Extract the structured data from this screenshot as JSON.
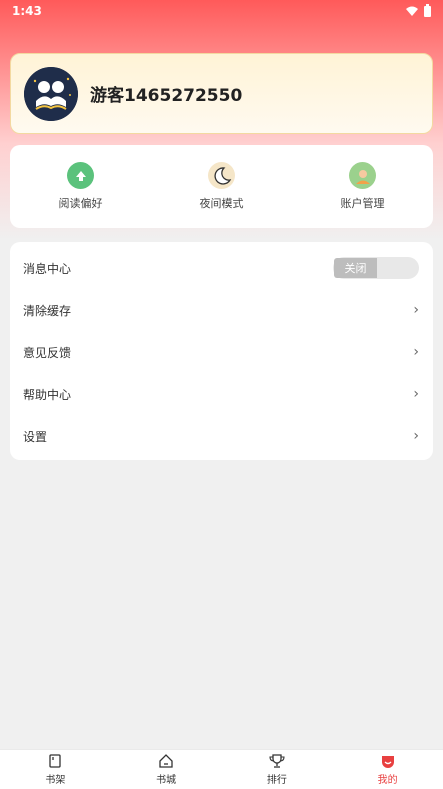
{
  "status_bar": {
    "time": "1:43"
  },
  "profile": {
    "username": "游客1465272550"
  },
  "quick_actions": [
    {
      "label": "阅读偏好",
      "icon": "upload-arrow-icon",
      "color": "#5bc27c"
    },
    {
      "label": "夜间模式",
      "icon": "moon-icon",
      "color": "#f5e6c8"
    },
    {
      "label": "账户管理",
      "icon": "account-icon",
      "color": "#9bd18d"
    }
  ],
  "menu": {
    "message_center": {
      "label": "消息中心",
      "toggle_state": "关闭"
    },
    "clear_cache": "清除缓存",
    "feedback": "意见反馈",
    "help_center": "帮助中心",
    "settings": "设置"
  },
  "tabs": [
    {
      "label": "书架",
      "icon": "bookshelf-icon"
    },
    {
      "label": "书城",
      "icon": "home-icon"
    },
    {
      "label": "排行",
      "icon": "trophy-icon"
    },
    {
      "label": "我的",
      "icon": "profile-icon",
      "active": true
    }
  ],
  "colors": {
    "accent": "#e84040",
    "header": "#ff5a5a"
  }
}
